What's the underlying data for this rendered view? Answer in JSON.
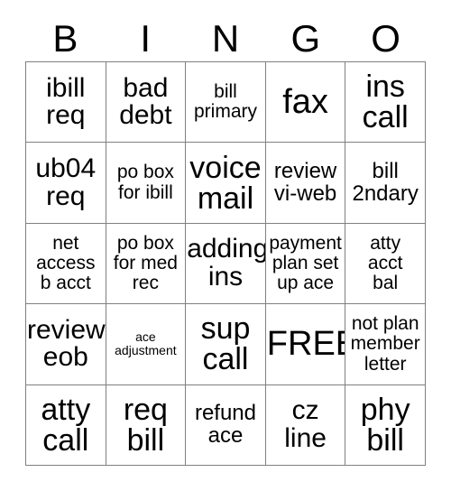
{
  "card": {
    "title": "BINGO",
    "header_letters": [
      "B",
      "I",
      "N",
      "G",
      "O"
    ],
    "free_space_label": "FREE",
    "colors": {
      "background": "#ffffff",
      "text": "#000000",
      "border": "#808080"
    },
    "grid": {
      "columns": 5,
      "rows": 5
    },
    "cells": [
      [
        {
          "text": "ibill\nreq",
          "size": "lg"
        },
        {
          "text": "bad\ndebt",
          "size": "lg"
        },
        {
          "text": "bill\nprimary",
          "size": "sm"
        },
        {
          "text": "fax",
          "size": "xxl"
        },
        {
          "text": "ins\ncall",
          "size": "xl"
        }
      ],
      [
        {
          "text": "ub04\nreq",
          "size": "lg"
        },
        {
          "text": "po box\nfor ibill",
          "size": "sm"
        },
        {
          "text": "voice\nmail",
          "size": "xl"
        },
        {
          "text": "review\nvi-web",
          "size": "md"
        },
        {
          "text": "bill\n2ndary",
          "size": "md"
        }
      ],
      [
        {
          "text": "net\naccess\nb acct",
          "size": "sm"
        },
        {
          "text": "po box\nfor med\nrec",
          "size": "sm"
        },
        {
          "text": "adding\nins",
          "size": "lg"
        },
        {
          "text": "payment\nplan set\nup ace",
          "size": "sm"
        },
        {
          "text": "atty\nacct\nbal",
          "size": "sm"
        }
      ],
      [
        {
          "text": "review\neob",
          "size": "lg"
        },
        {
          "text": "ace\nadjustment",
          "size": "xs"
        },
        {
          "text": "sup\ncall",
          "size": "xl"
        },
        {
          "text": "FREE",
          "size": "xxl"
        },
        {
          "text": "not plan\nmember\nletter",
          "size": "sm"
        }
      ],
      [
        {
          "text": "atty\ncall",
          "size": "xl"
        },
        {
          "text": "req\nbill",
          "size": "xl"
        },
        {
          "text": "refund\nace",
          "size": "md"
        },
        {
          "text": "cz\nline",
          "size": "lg"
        },
        {
          "text": "phy\nbill",
          "size": "xl"
        }
      ]
    ]
  }
}
